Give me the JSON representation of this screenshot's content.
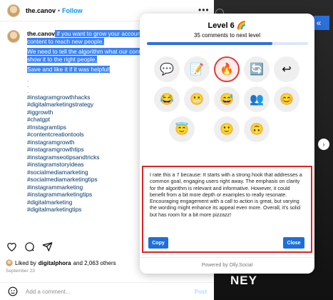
{
  "post": {
    "username": "the.canov",
    "dot": "•",
    "follow_label": "Follow",
    "more": "•••",
    "caption": {
      "username": "the.canov",
      "line1": " if you want to grow your account",
      "line1b": "content to reach new people.",
      "para2a": "We need to tell the algorithm what our content is about to",
      "para2b": "show it to the right people.",
      "para3": "Save and like it if it was helpful!",
      "dots": [
        ".",
        ".",
        "."
      ],
      "hashtags": [
        "#instagramgrowthhacks",
        "#digitalmarketingstrategy",
        "#iggrowth",
        "#chatgpt",
        "#Instagramtips",
        "#contentcreationtools",
        "#instagramgrowth",
        "#instagramgrowthtips",
        "#instagramseotipsandtricks",
        "#instagramstoryideas",
        "#socialmediamarketing",
        "#socialmediamarketingtips",
        "#instagrammarketing",
        "#instagrammarketingtips",
        "#digitalmarketing",
        "#digitalmarketingtips"
      ]
    },
    "liked_prefix": "Liked by",
    "liked_user": "digitalphora",
    "liked_suffix": "and 2,063 others",
    "date": "September 23",
    "comment_placeholder": "Add a comment...",
    "post_label": "Post"
  },
  "photo": {
    "label": "NEY",
    "ext_icon": "«"
  },
  "popup": {
    "level_title": "Level 6 🌈",
    "next_level": "35 comments to next level",
    "progress_fraction": 0.78,
    "emojis": [
      {
        "icon": "speech-bubble-icon",
        "glyph": "💬"
      },
      {
        "icon": "memo-icon",
        "glyph": "📝"
      },
      {
        "icon": "fire-icon",
        "glyph": "🔥",
        "selected": true
      },
      {
        "icon": "repeat-icon",
        "glyph": "🔄"
      },
      {
        "icon": "return-icon",
        "glyph": "↩"
      },
      {
        "icon": "laughing-face-icon",
        "glyph": "😂"
      },
      {
        "icon": "grimacing-face-icon",
        "glyph": "😬"
      },
      {
        "icon": "sweat-smile-icon",
        "glyph": "😅"
      },
      {
        "icon": "group-icon",
        "glyph": "👥"
      },
      {
        "icon": "smiling-face-icon",
        "glyph": "😊"
      },
      {
        "icon": "starstruck-face-icon",
        "glyph": "😇"
      },
      {
        "icon": "slight-smile-icon",
        "glyph": "🙂"
      },
      {
        "icon": "upside-down-face-icon",
        "glyph": "🙃"
      }
    ],
    "feedback": "I rate this a 7 because: It starts with a strong hook that addresses a common goal, engaging users right away. The emphasis on clarity for the algorithm is relevant and informative. However, it could benefit from a bit more depth or examples to really resonate. Encouraging engagement with a call to action is great, but varying the wording might enhance its appeal even more. Overall, it's solid but has room for a bit more pizzazz!",
    "copy_label": "Copy",
    "close_label": "Close",
    "powered_by": "Powered by Olly.Social"
  },
  "colors": {
    "accent": "#1e6fd9",
    "highlight": "#3b82f6",
    "feedback_border": "#e02424"
  }
}
